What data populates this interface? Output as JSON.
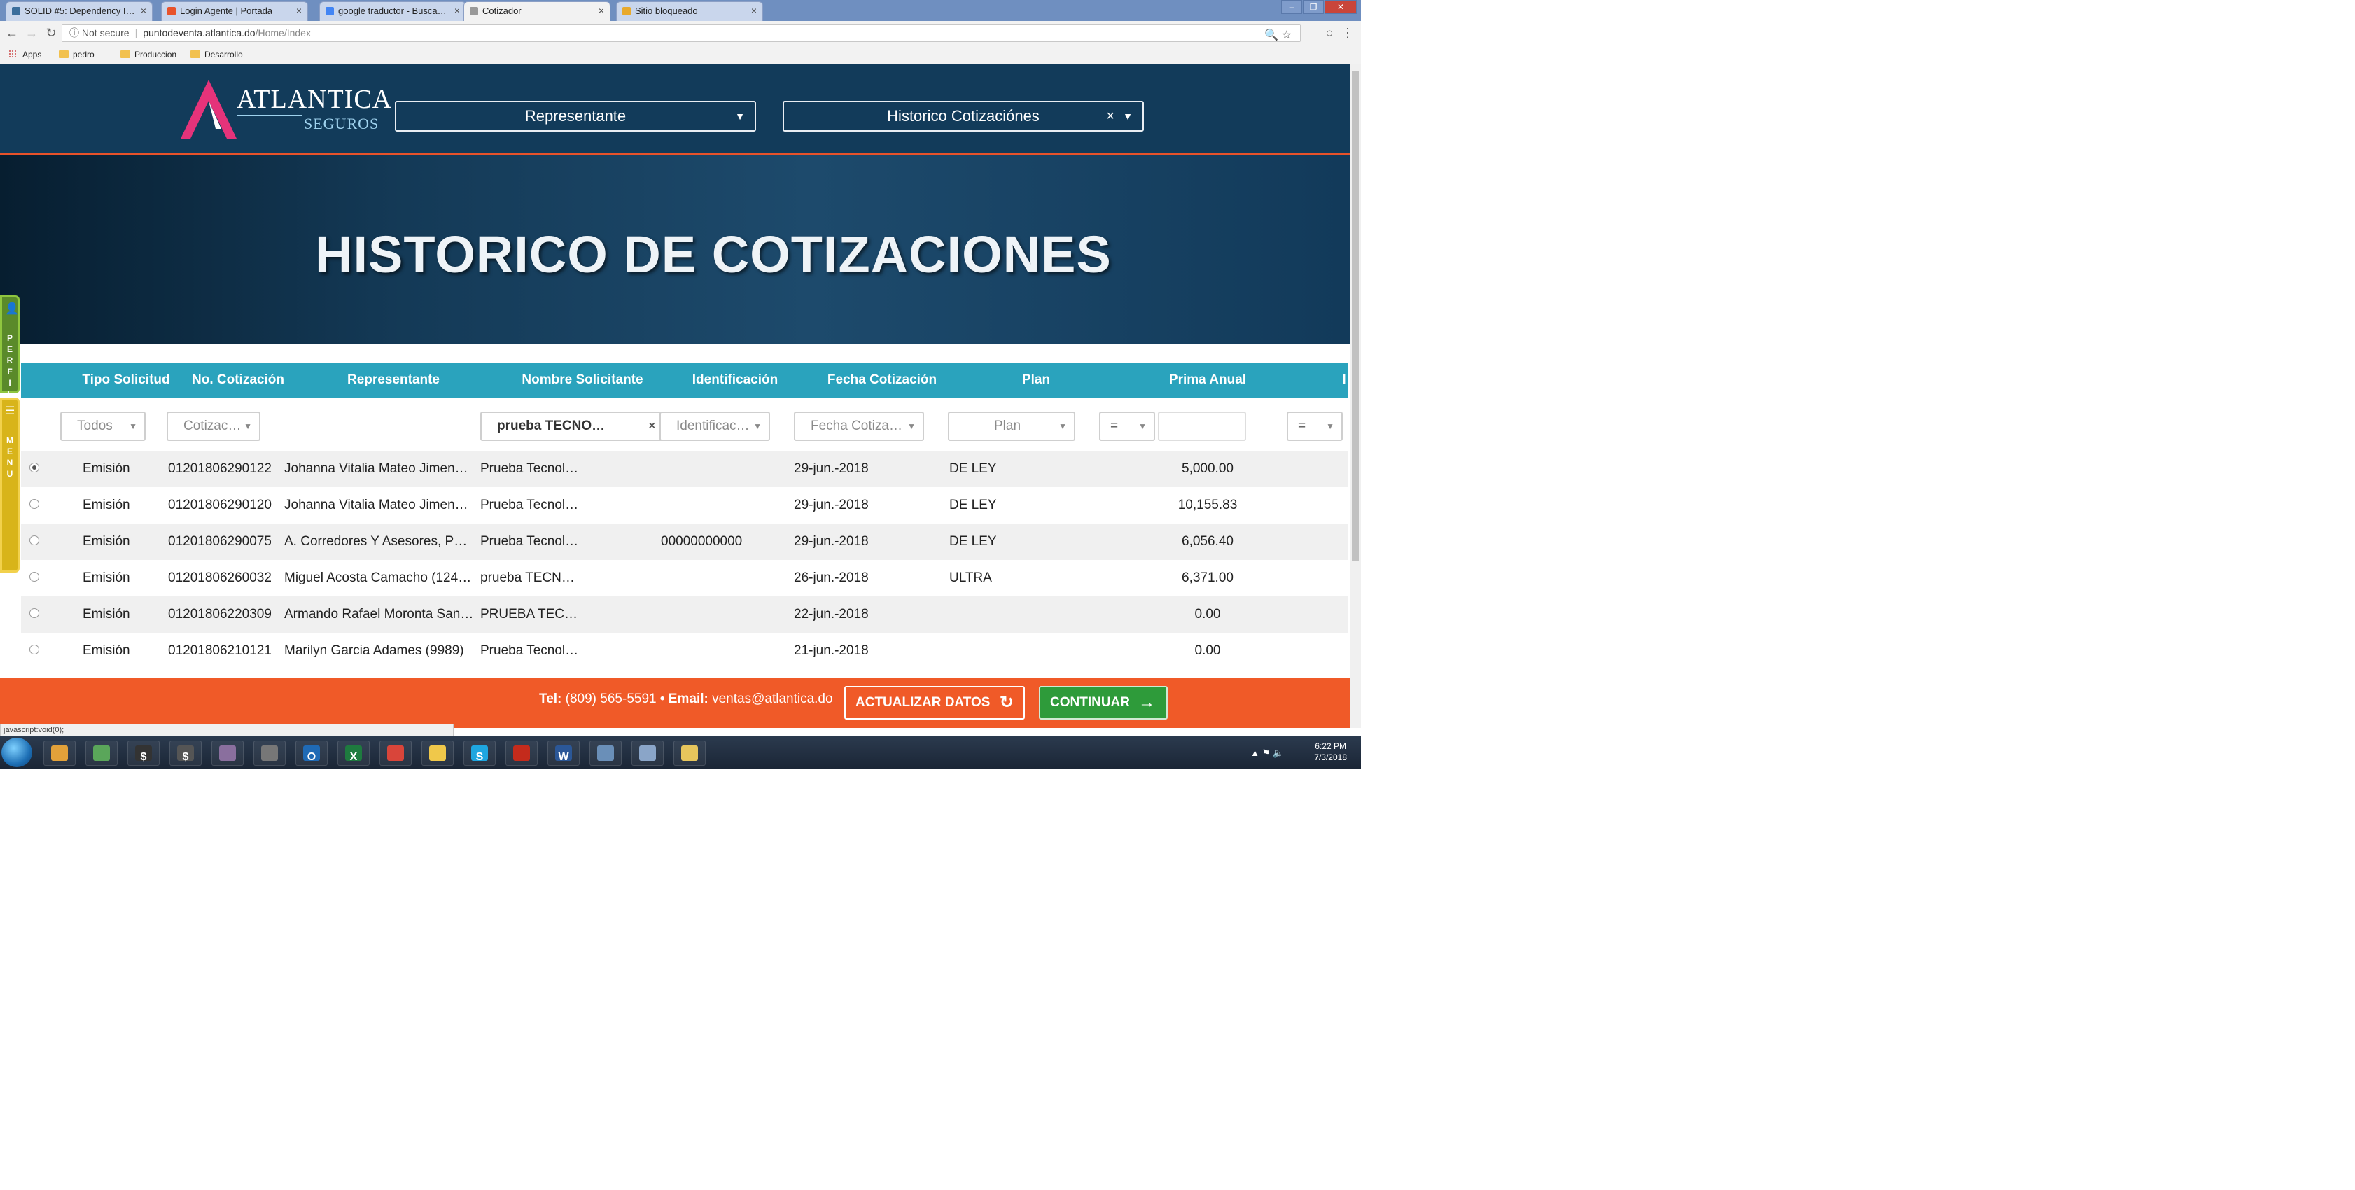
{
  "browser": {
    "tabs": [
      {
        "label": "SOLID #5: Dependency I…",
        "color": "#3b6e9c",
        "active": false
      },
      {
        "label": "Login Agente | Portada",
        "color": "#e8532b",
        "active": false
      },
      {
        "label": "google traductor - Busca…",
        "color": "#4285f4",
        "active": false
      },
      {
        "label": "Cotizador",
        "color": "#999999",
        "active": true
      },
      {
        "label": "Sitio bloqueado",
        "color": "#e8a92b",
        "active": false
      }
    ],
    "tab_close": "×",
    "back": "←",
    "forward": "→",
    "reload": "↻",
    "security": "ⓘ Not secure",
    "url_host": "puntodeventa.atlantica.do",
    "url_path": "/Home/Index",
    "bookmarks": [
      {
        "label": "Apps",
        "icon": "apps-grid-icon"
      },
      {
        "label": "pedro",
        "icon": "folder-icon"
      },
      {
        "label": "Produccion",
        "icon": "folder-icon"
      },
      {
        "label": "Desarrollo",
        "icon": "folder-icon"
      }
    ],
    "status_text": "javascript:void(0);"
  },
  "header": {
    "logo_word": "ATLANTICA",
    "logo_sub": "SEGUROS",
    "select_representante": "Representante",
    "select_historico": "Historico Cotizaciónes"
  },
  "banner": {
    "title": "HISTORICO DE COTIZACIONES"
  },
  "side": {
    "perfil": "PERFIL",
    "menu": "MENU"
  },
  "table": {
    "columns": [
      "Tipo Solicitud",
      "No. Cotización",
      "Representante",
      "Nombre Solicitante",
      "Identificación",
      "Fecha Cotización",
      "Plan",
      "Prima Anual",
      "I"
    ],
    "filters": {
      "tipo": "Todos",
      "cotizacion": "Cotizac…",
      "nombre": "prueba TECNO…",
      "identificacion": "Identificac…",
      "fecha": "Fecha Cotiza…",
      "plan": "Plan",
      "prima_op": "=",
      "prima_value": "",
      "last_op": "="
    },
    "rows": [
      {
        "tipo": "Emisión",
        "cotizacion": "01201806290122",
        "representante": "Johanna Vitalia Mateo Jimen…",
        "nombre": "Prueba Tecnol…",
        "identificacion": "",
        "fecha": "29-jun.-2018",
        "plan": "DE LEY",
        "prima": "5,000.00",
        "selected": true
      },
      {
        "tipo": "Emisión",
        "cotizacion": "01201806290120",
        "representante": "Johanna Vitalia Mateo Jimen…",
        "nombre": "Prueba Tecnol…",
        "identificacion": "",
        "fecha": "29-jun.-2018",
        "plan": "DE LEY",
        "prima": "10,155.83",
        "selected": false
      },
      {
        "tipo": "Emisión",
        "cotizacion": "01201806290075",
        "representante": "A. Corredores Y Asesores, P…",
        "nombre": "Prueba Tecnol…",
        "identificacion": "00000000000",
        "fecha": "29-jun.-2018",
        "plan": "DE LEY",
        "prima": "6,056.40",
        "selected": false
      },
      {
        "tipo": "Emisión",
        "cotizacion": "01201806260032",
        "representante": "Miguel Acosta Camacho (124…",
        "nombre": "prueba TECN…",
        "identificacion": "",
        "fecha": "26-jun.-2018",
        "plan": "ULTRA",
        "prima": "6,371.00",
        "selected": false
      },
      {
        "tipo": "Emisión",
        "cotizacion": "01201806220309",
        "representante": "Armando Rafael Moronta San…",
        "nombre": "PRUEBA TEC…",
        "identificacion": "",
        "fecha": "22-jun.-2018",
        "plan": "",
        "prima": "0.00",
        "selected": false
      },
      {
        "tipo": "Emisión",
        "cotizacion": "01201806210121",
        "representante": "Marilyn Garcia Adames (9989)",
        "nombre": "Prueba Tecnol…",
        "identificacion": "",
        "fecha": "21-jun.-2018",
        "plan": "",
        "prima": "0.00",
        "selected": false
      }
    ]
  },
  "footer": {
    "tel_label": "Tel:",
    "tel": "(809) 565-5591",
    "email_label": "• Email:",
    "email": "ventas@atlantica.do",
    "update_label": "ACTUALIZAR DATOS",
    "continue_label": "CONTINUAR"
  },
  "taskbar": {
    "items": [
      {
        "name": "media-player-icon",
        "color": "#e2a13a",
        "glyph": ""
      },
      {
        "name": "photos-icon",
        "color": "#5aa65a",
        "glyph": ""
      },
      {
        "name": "dollar-app-icon",
        "color": "#333333",
        "glyph": "$"
      },
      {
        "name": "finance-app-icon",
        "color": "#555555",
        "glyph": "$"
      },
      {
        "name": "network-icon",
        "color": "#8a6f9e",
        "glyph": ""
      },
      {
        "name": "tools-icon",
        "color": "#777777",
        "glyph": ""
      },
      {
        "name": "outlook-icon",
        "color": "#1f6ab5",
        "glyph": "O"
      },
      {
        "name": "excel-icon",
        "color": "#1e7b3f",
        "glyph": "X"
      },
      {
        "name": "chrome-icon",
        "color": "#d9453a",
        "glyph": ""
      },
      {
        "name": "cloud-icon",
        "color": "#f0c84a",
        "glyph": ""
      },
      {
        "name": "skype-icon",
        "color": "#1ea6e0",
        "glyph": "S"
      },
      {
        "name": "acrobat-icon",
        "color": "#c42b1c",
        "glyph": ""
      },
      {
        "name": "word-icon",
        "color": "#2b5797",
        "glyph": "W"
      },
      {
        "name": "window-icon",
        "color": "#6a8fb8",
        "glyph": ""
      },
      {
        "name": "document-icon",
        "color": "#8aa5c8",
        "glyph": ""
      },
      {
        "name": "explorer-icon",
        "color": "#e6c55c",
        "glyph": ""
      }
    ],
    "time": "6:22 PM",
    "date": "7/3/2018"
  }
}
